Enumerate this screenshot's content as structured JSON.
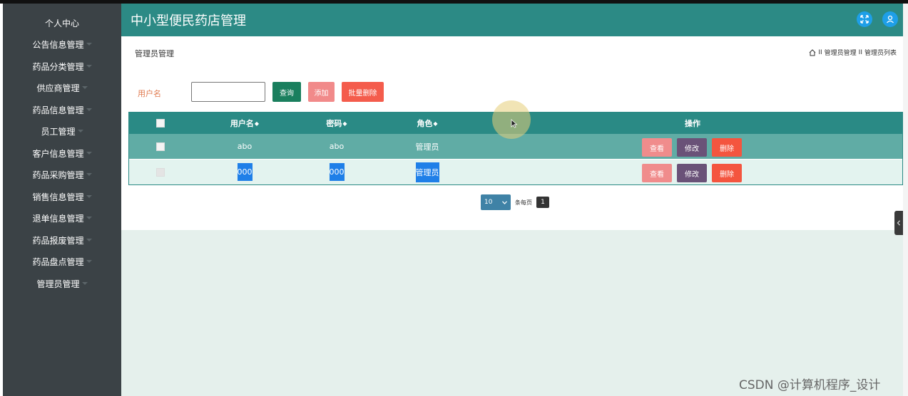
{
  "app": {
    "title": "中小型便民药店管理"
  },
  "sidebar": {
    "items": [
      {
        "label": "个人中心",
        "caret": false
      },
      {
        "label": "公告信息管理",
        "caret": true
      },
      {
        "label": "药品分类管理",
        "caret": true
      },
      {
        "label": "供应商管理",
        "caret": true
      },
      {
        "label": "药品信息管理",
        "caret": true
      },
      {
        "label": "员工管理",
        "caret": true
      },
      {
        "label": "客户信息管理",
        "caret": true
      },
      {
        "label": "药品采购管理",
        "caret": true
      },
      {
        "label": "销售信息管理",
        "caret": true
      },
      {
        "label": "退单信息管理",
        "caret": true
      },
      {
        "label": "药品报废管理",
        "caret": true
      },
      {
        "label": "药品盘点管理",
        "caret": true
      },
      {
        "label": "管理员管理",
        "caret": true
      }
    ]
  },
  "header": {
    "icons": [
      "fullscreen-icon",
      "user-icon"
    ]
  },
  "page": {
    "title": "管理员管理",
    "breadcrumb": {
      "sep": "II",
      "level1": "管理员管理",
      "level2": "管理员列表"
    }
  },
  "search": {
    "label": "用户名",
    "value": "",
    "query_label": "查询",
    "add_label": "添加",
    "batch_delete_label": "批量删除"
  },
  "table": {
    "columns": [
      "用户名",
      "密码",
      "角色",
      "操作"
    ],
    "sort_glyph": "◆",
    "rows": [
      {
        "username": "abo",
        "password": "abo",
        "role": "管理员"
      },
      {
        "username": "000",
        "password": "000",
        "role": "管理员"
      }
    ],
    "actions": {
      "view": "查看",
      "edit": "修改",
      "delete": "删除"
    }
  },
  "pagination": {
    "page_size": "10",
    "per_page_label": "条每页",
    "current_page": "1"
  },
  "watermark": "CSDN @计算机程序_设计",
  "colors": {
    "sidebar_bg": "#3b4246",
    "header_bg": "#2c8a85",
    "query": "#1a7f5e",
    "add": "#f18a8a",
    "batch_delete": "#f45c4c",
    "view": "#f08c8c",
    "edit": "#6a5278",
    "delete": "#f4553f"
  }
}
